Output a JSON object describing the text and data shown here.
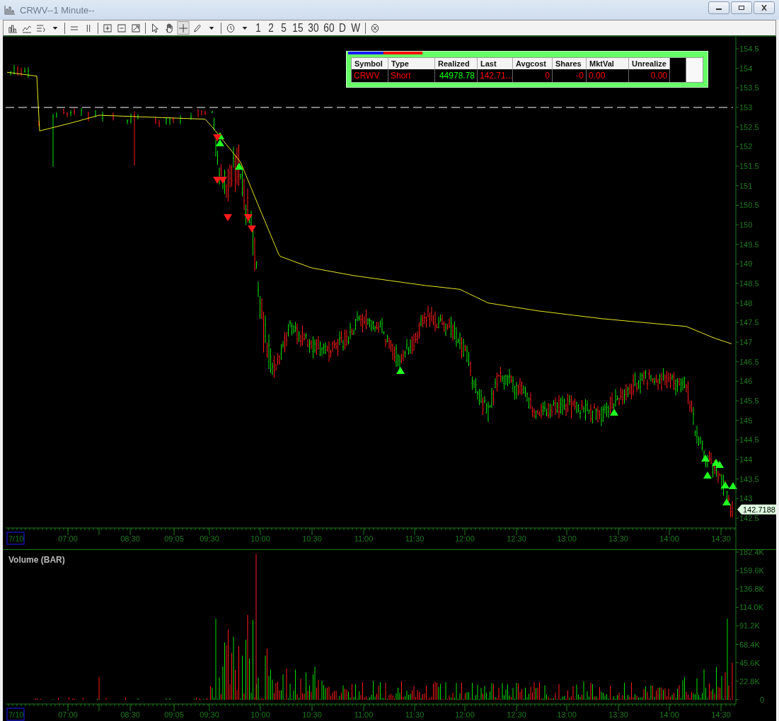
{
  "window": {
    "title": "CRWV--1 Minute--"
  },
  "toolbar": {
    "drawing_tools": [
      {
        "selected": false
      },
      {
        "selected": false
      },
      {
        "selected": true
      },
      {
        "selected": false
      }
    ],
    "intervals": [
      {
        "label": "1",
        "selected": false
      },
      {
        "label": "2",
        "selected": false
      },
      {
        "label": "5",
        "selected": false
      },
      {
        "label": "15",
        "selected": false
      },
      {
        "label": "30",
        "selected": false
      },
      {
        "label": "60",
        "selected": false
      },
      {
        "label": "D",
        "selected": false
      },
      {
        "label": "W",
        "selected": false
      }
    ]
  },
  "position_table": {
    "columns": [
      "Symbol",
      "Type",
      "Realized",
      "Last",
      "Avgcost",
      "Shares",
      "MktVal",
      "Unrealize"
    ],
    "rows": [
      {
        "cells": [
          "CRWV",
          "Short",
          "44978.78",
          "142.71...",
          "0",
          "-0",
          "0.00",
          "0.00"
        ]
      }
    ]
  },
  "price_axis": {
    "labels": [
      "154.5",
      "154",
      "153.5",
      "153",
      "152.5",
      "152",
      "151.5",
      "151",
      "150.5",
      "150",
      "149.5",
      "149",
      "148.5",
      "148",
      "147.5",
      "147",
      "146.5",
      "146",
      "145.5",
      "145",
      "144.5",
      "144",
      "143.5",
      "143",
      "142.5"
    ],
    "last_price": "142.7188"
  },
  "time_axis": {
    "date": "7/10",
    "labels": [
      "07:00",
      "08:30",
      "09:05",
      "09:30",
      "10:00",
      "10:30",
      "11:00",
      "11:30",
      "12:00",
      "12:30",
      "13:00",
      "13:30",
      "14:00",
      "14:30"
    ]
  },
  "volume_pane": {
    "title": "Volume (BAR)",
    "labels": [
      "182.4K",
      "159.6K",
      "136.8K",
      "114.0K",
      "91.2K",
      "68.4K",
      "45.6K",
      "22.8K",
      "0"
    ],
    "time_axis": {
      "date": "7/10",
      "labels": [
        "07:00",
        "08:30",
        "09:05",
        "09:30",
        "10:00",
        "10:30",
        "11:00",
        "11:30",
        "12:00",
        "12:30",
        "13:00",
        "13:30",
        "14:00",
        "14:30"
      ]
    }
  }
}
